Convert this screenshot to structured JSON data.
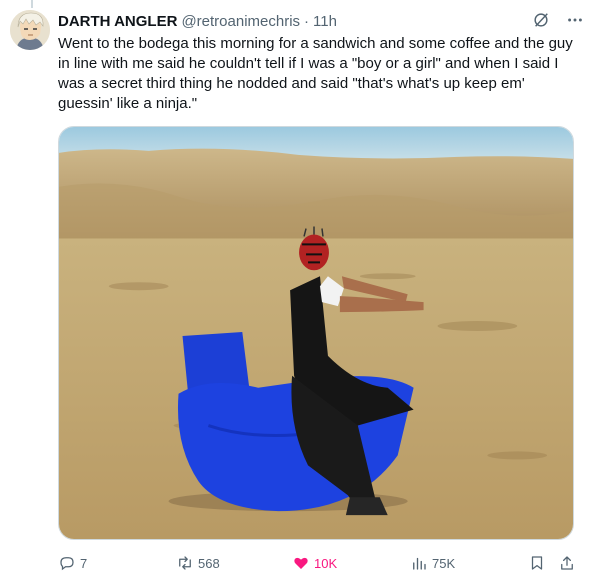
{
  "tweet": {
    "author_name": "DARTH ANGLER",
    "handle": "@retroanimechris",
    "separator": "·",
    "time": "11h",
    "text": "Went to the bodega this morning for a sandwich and some coffee and the guy in line with me said he couldn't tell if I was a \"boy or a girl\" and when I said I was a secret third thing he nodded and said \"that's what's up keep em' guessin' like a ninja.\"",
    "media_icon": "costumed-figure-on-blue-hobby-horse-desert-photo"
  },
  "header_icons": [
    "grok-slash-icon",
    "more-icon"
  ],
  "actions": {
    "reply_count": "7",
    "retweet_count": "568",
    "like_count": "10K",
    "views_count": "75K"
  },
  "colors": {
    "like_active": "#f91880",
    "secondary_text": "#536471",
    "border": "#cfd9de"
  }
}
